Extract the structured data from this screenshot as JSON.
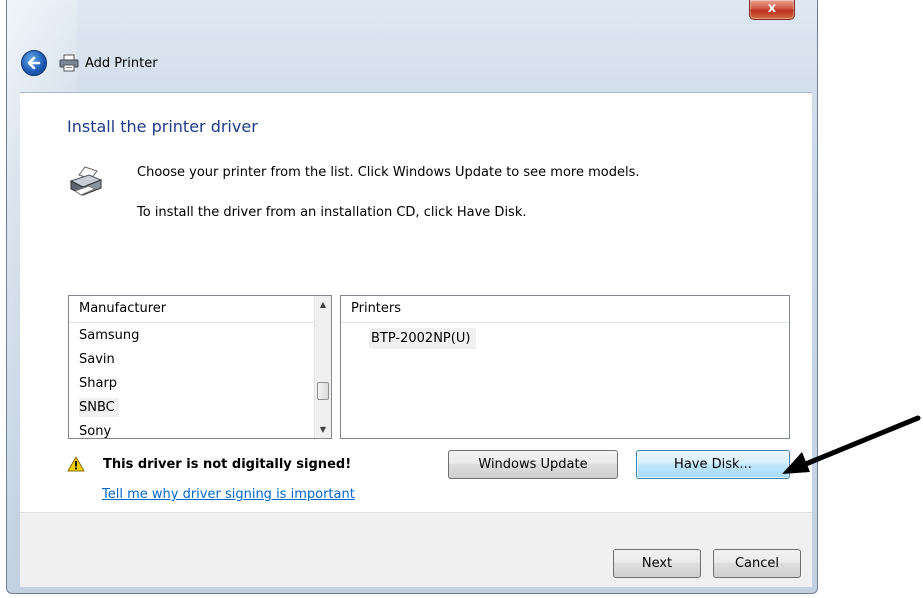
{
  "window": {
    "title": "Add Printer",
    "close_glyph": "x"
  },
  "page": {
    "heading": "Install the printer driver",
    "description_1": "Choose your printer from the list. Click Windows Update to see more models.",
    "description_2": "To install the driver from an installation CD, click Have Disk."
  },
  "manufacturer_list": {
    "header": "Manufacturer",
    "items": [
      {
        "label": "Samsung",
        "selected": false
      },
      {
        "label": "Savin",
        "selected": false
      },
      {
        "label": "Sharp",
        "selected": false
      },
      {
        "label": "SNBC",
        "selected": true
      },
      {
        "label": "Sony",
        "selected": false
      }
    ]
  },
  "printers_list": {
    "header": "Printers",
    "items": [
      {
        "label": "BTP-2002NP(U)",
        "selected": true
      }
    ]
  },
  "warning": {
    "text": "This driver is not digitally signed!",
    "link": "Tell me why driver signing is important"
  },
  "buttons": {
    "windows_update": "Windows Update",
    "have_disk": "Have Disk...",
    "next": "Next",
    "cancel": "Cancel"
  },
  "colors": {
    "heading": "#1e3a8a",
    "link": "#0066cc",
    "focused_button_border": "#3c7fb1"
  },
  "icons": {
    "back": "back-arrow-icon",
    "title": "printer-icon",
    "page": "printer-icon",
    "warning": "warning-icon",
    "annotation": "annotation-arrow"
  }
}
